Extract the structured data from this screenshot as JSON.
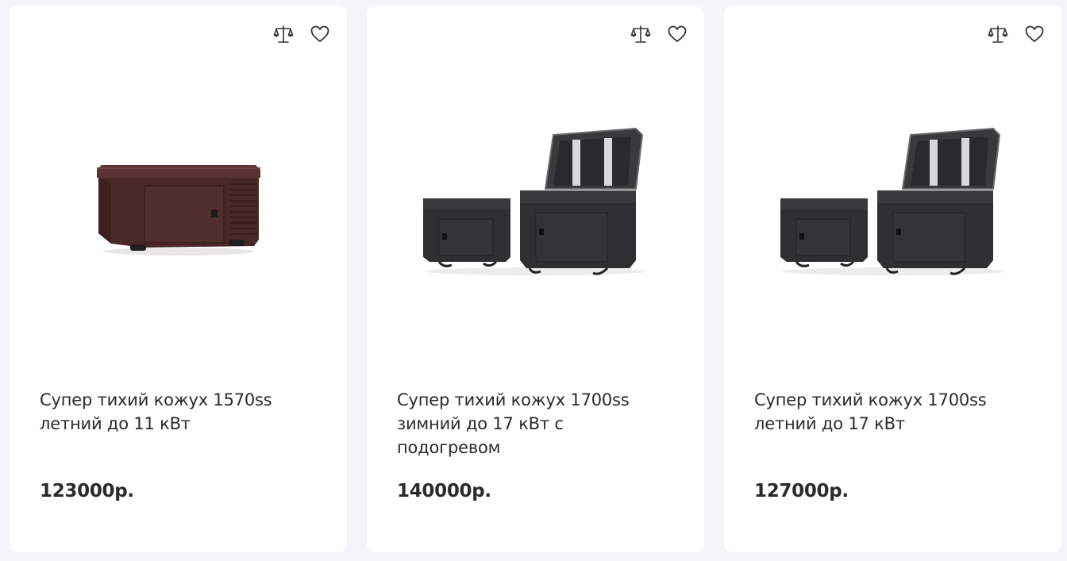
{
  "products": [
    {
      "title": "Супер тихий кожух 1570ss летний до 11 кВт",
      "price": "123000р.",
      "image": "single-enclosure-brown",
      "icons": [
        "compare-icon",
        "favorite-heart-icon"
      ]
    },
    {
      "title": "Супер тихий кожух 1700ss зимний до 17 кВт с подогревом",
      "price": "140000р.",
      "image": "two-enclosures-black-open-lid",
      "icons": [
        "compare-icon",
        "favorite-heart-icon"
      ]
    },
    {
      "title": "Супер тихий кожух 1700ss летний до 17 кВт",
      "price": "127000р.",
      "image": "two-enclosures-black-open-lid",
      "icons": [
        "compare-icon",
        "favorite-heart-icon"
      ]
    }
  ],
  "colors": {
    "page_bg": "#f4f4f9",
    "card_bg": "#ffffff",
    "text": "#2b2b2b",
    "icon": "#333333",
    "enclosure_brown": "#4a2a2a",
    "enclosure_black": "#2f2f31"
  }
}
